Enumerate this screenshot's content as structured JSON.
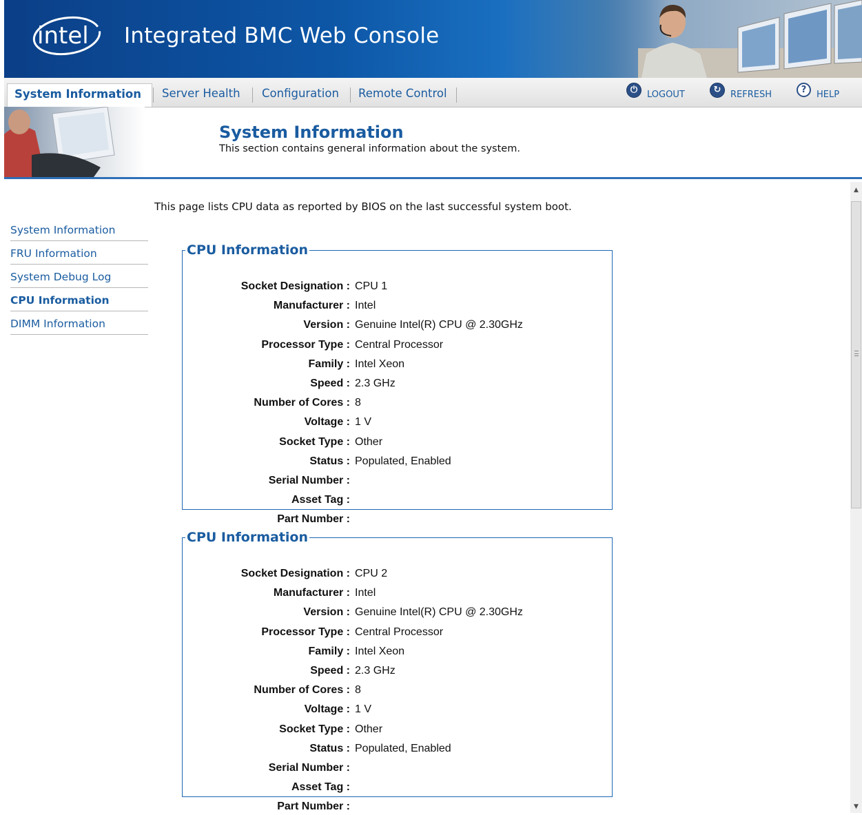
{
  "header": {
    "logo_text": "intel",
    "title": "Integrated BMC Web Console"
  },
  "nav": {
    "tabs": [
      {
        "label": "System Information",
        "active": true
      },
      {
        "label": "Server Health",
        "active": false
      },
      {
        "label": "Configuration",
        "active": false
      },
      {
        "label": "Remote Control",
        "active": false
      }
    ],
    "links": {
      "logout": "LOGOUT",
      "refresh": "REFRESH",
      "help": "HELP"
    }
  },
  "section": {
    "title": "System Information",
    "description": "This section contains general information about the system."
  },
  "sidebar": {
    "items": [
      {
        "label": "System Information",
        "active": false
      },
      {
        "label": "FRU Information",
        "active": false
      },
      {
        "label": "System Debug Log",
        "active": false
      },
      {
        "label": "CPU Information",
        "active": true
      },
      {
        "label": "DIMM Information",
        "active": false
      }
    ]
  },
  "main": {
    "intro": "This page lists CPU data as reported by BIOS on the last successful system boot.",
    "cpus": [
      {
        "legend": "CPU Information",
        "fields": [
          {
            "label": "Socket Designation :",
            "value": "CPU 1"
          },
          {
            "label": "Manufacturer :",
            "value": "Intel"
          },
          {
            "label": "Version :",
            "value": "Genuine Intel(R) CPU @ 2.30GHz"
          },
          {
            "label": "Processor Type :",
            "value": "Central Processor"
          },
          {
            "label": "Family :",
            "value": "Intel Xeon"
          },
          {
            "label": "Speed :",
            "value": "2.3 GHz"
          },
          {
            "label": "Number of Cores :",
            "value": "8"
          },
          {
            "label": "Voltage :",
            "value": "1 V"
          },
          {
            "label": "Socket Type :",
            "value": "Other"
          },
          {
            "label": "Status :",
            "value": "Populated, Enabled"
          },
          {
            "label": "Serial Number :",
            "value": ""
          },
          {
            "label": "Asset Tag :",
            "value": ""
          },
          {
            "label": "Part Number :",
            "value": ""
          }
        ]
      },
      {
        "legend": "CPU Information",
        "fields": [
          {
            "label": "Socket Designation :",
            "value": "CPU 2"
          },
          {
            "label": "Manufacturer :",
            "value": "Intel"
          },
          {
            "label": "Version :",
            "value": "Genuine Intel(R) CPU @ 2.30GHz"
          },
          {
            "label": "Processor Type :",
            "value": "Central Processor"
          },
          {
            "label": "Family :",
            "value": "Intel Xeon"
          },
          {
            "label": "Speed :",
            "value": "2.3 GHz"
          },
          {
            "label": "Number of Cores :",
            "value": "8"
          },
          {
            "label": "Voltage :",
            "value": "1 V"
          },
          {
            "label": "Socket Type :",
            "value": "Other"
          },
          {
            "label": "Status :",
            "value": "Populated, Enabled"
          },
          {
            "label": "Serial Number :",
            "value": ""
          },
          {
            "label": "Asset Tag :",
            "value": ""
          },
          {
            "label": "Part Number :",
            "value": ""
          }
        ]
      }
    ]
  },
  "icons": {
    "logout": "logout-icon",
    "refresh": "refresh-icon",
    "help": "help-icon"
  },
  "colors": {
    "brand_blue": "#0d56a6",
    "link_blue": "#1a5ca0",
    "rule_blue": "#2e6fb6"
  }
}
